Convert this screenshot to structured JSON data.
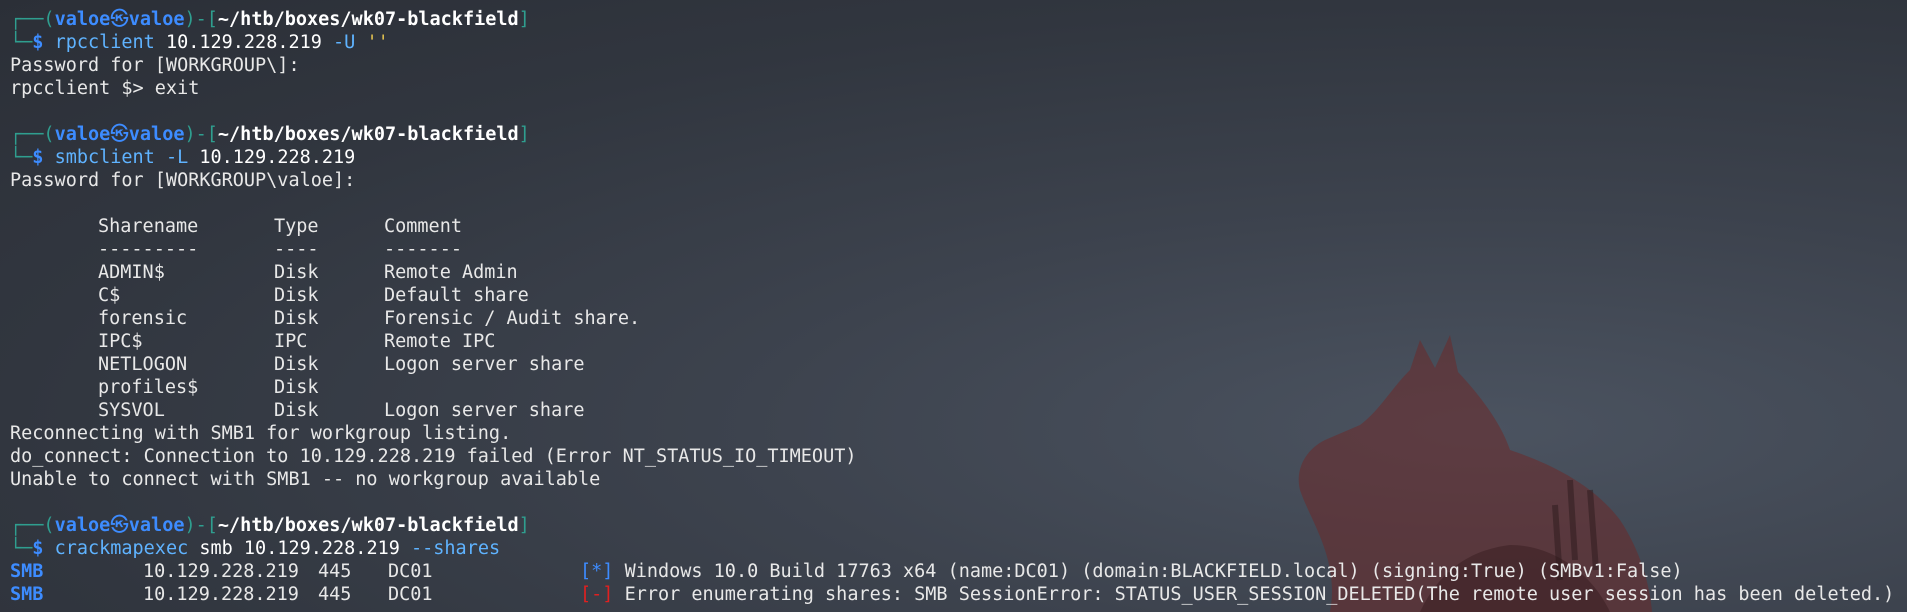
{
  "prompt": {
    "open": "┌──(",
    "user": "valoe",
    "at": "㉿",
    "host": "valoe",
    "mid": ")-[",
    "path": "~/htb/boxes/wk07-blackfield",
    "close": "]",
    "corner": "└─",
    "dollar": "$"
  },
  "cmd1": {
    "name": "rpcclient",
    "ip": "10.129.228.219",
    "opt": "-U",
    "str": "''"
  },
  "out1": [
    "Password for [WORKGROUP\\]:",
    "rpcclient $> exit"
  ],
  "cmd2": {
    "name": "smbclient",
    "opt": "-L",
    "ip": "10.129.228.219"
  },
  "out2_pw": "Password for [WORKGROUP\\valoe]:",
  "shares": {
    "headers": [
      "Sharename",
      "Type",
      "Comment"
    ],
    "separators": [
      "---------",
      "----",
      "-------"
    ],
    "rows": [
      [
        "ADMIN$",
        "Disk",
        "Remote Admin"
      ],
      [
        "C$",
        "Disk",
        "Default share"
      ],
      [
        "forensic",
        "Disk",
        "Forensic / Audit share."
      ],
      [
        "IPC$",
        "IPC",
        "Remote IPC"
      ],
      [
        "NETLOGON",
        "Disk",
        "Logon server share"
      ],
      [
        "profiles$",
        "Disk",
        ""
      ],
      [
        "SYSVOL",
        "Disk",
        "Logon server share"
      ]
    ]
  },
  "out2_tail": [
    "Reconnecting with SMB1 for workgroup listing.",
    "do_connect: Connection to 10.129.228.219 failed (Error NT_STATUS_IO_TIMEOUT)",
    "Unable to connect with SMB1 -- no workgroup available"
  ],
  "cmd3": {
    "name": "crackmapexec",
    "arg1": "smb",
    "ip": "10.129.228.219",
    "opt": "--shares"
  },
  "smb_rows": [
    {
      "proto": "SMB",
      "ip": "10.129.228.219",
      "port": "445",
      "host": "DC01",
      "marker": "[*]",
      "msg": "Windows 10.0 Build 17763 x64 (name:DC01) (domain:BLACKFIELD.local) (signing:True) (SMBv1:False)"
    },
    {
      "proto": "SMB",
      "ip": "10.129.228.219",
      "port": "445",
      "host": "DC01",
      "marker": "[-]",
      "msg": "Error enumerating shares: SMB SessionError: STATUS_USER_SESSION_DELETED(The remote user session has been deleted.)"
    }
  ],
  "colors": {
    "background": "#31363f",
    "accent": "#3d8cff",
    "frame": "#2f9e8f",
    "error": "#e02020"
  }
}
